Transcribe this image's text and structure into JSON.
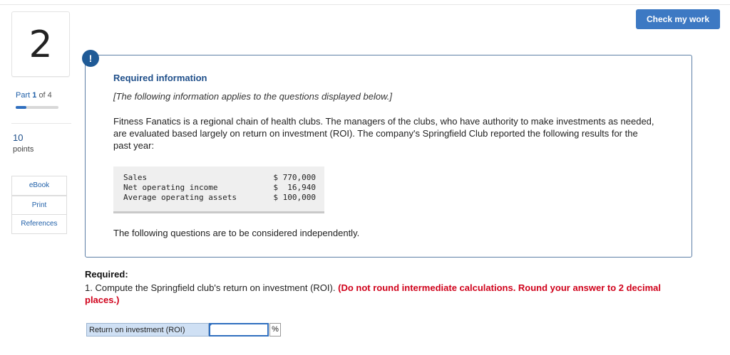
{
  "question": {
    "number": "2",
    "part_label_prefix": "Part",
    "part_current": "1",
    "part_of": "of 4",
    "progress_fraction": 0.25,
    "points_value": "10",
    "points_label": "points"
  },
  "resources": {
    "ebook": "eBook",
    "print": "Print",
    "references": "References"
  },
  "header": {
    "check_my_work": "Check my work"
  },
  "alert_icon": "!",
  "info_panel": {
    "title": "Required information",
    "applies": "[The following information applies to the questions displayed below.]",
    "paragraph": "Fitness Fanatics is a regional chain of health clubs. The managers of the clubs, who have authority to make investments as needed, are evaluated based largely on return on investment (ROI). The company's Springfield Club reported the following results for the past year:",
    "table": [
      {
        "label": "Sales",
        "value": "$ 770,000"
      },
      {
        "label": "Net operating income",
        "value": "$  16,940"
      },
      {
        "label": "Average operating assets",
        "value": "$ 100,000"
      }
    ],
    "independent_note": "The following questions are to be considered independently."
  },
  "required": {
    "heading": "Required:",
    "q1_text": "1. Compute the Springfield club's return on investment (ROI).",
    "q1_instruction": "(Do not round intermediate calculations. Round your answer to 2 decimal places.)"
  },
  "answer": {
    "label": "Return on investment (ROI)",
    "value": "",
    "unit": "%"
  },
  "colors": {
    "accent": "#3d79c3",
    "alert": "#1f5a96",
    "instruction_red": "#d0021b"
  }
}
